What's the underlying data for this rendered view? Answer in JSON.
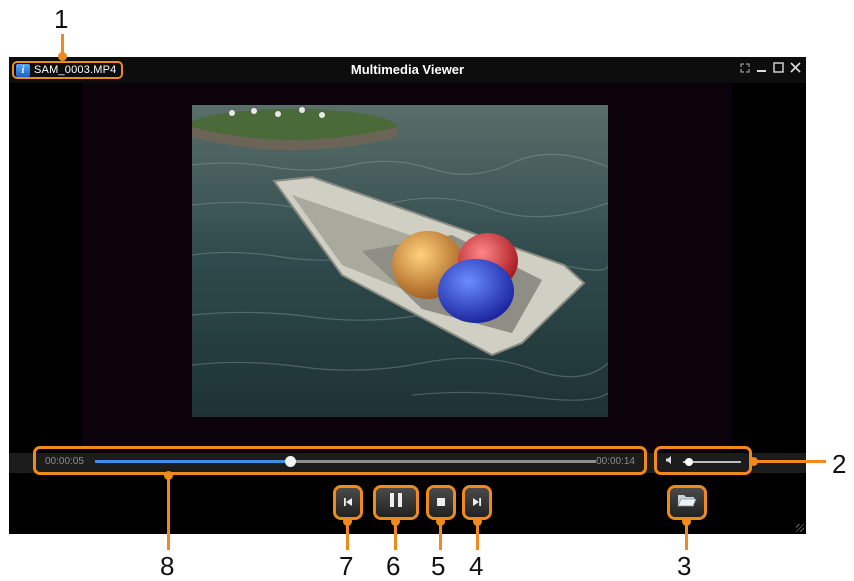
{
  "callouts": {
    "n1": "1",
    "n2": "2",
    "n3": "3",
    "n4": "4",
    "n5": "5",
    "n6": "6",
    "n7": "7",
    "n8": "8"
  },
  "window": {
    "title": "Multimedia Viewer",
    "file_name": "SAM_0003.MP4",
    "controls": [
      "fullscreen-icon",
      "minimize-icon",
      "maximize-icon",
      "close-icon"
    ]
  },
  "player": {
    "current_time": "00:00:05",
    "total_time": "00:00:14",
    "progress": 0.39,
    "volume": 0.1
  },
  "colors": {
    "accent": "#f08a1c",
    "seek_fill": "#3b8fe6"
  },
  "buttons": [
    "previous-icon",
    "pause-icon",
    "stop-icon",
    "next-icon",
    "open-folder-icon"
  ]
}
